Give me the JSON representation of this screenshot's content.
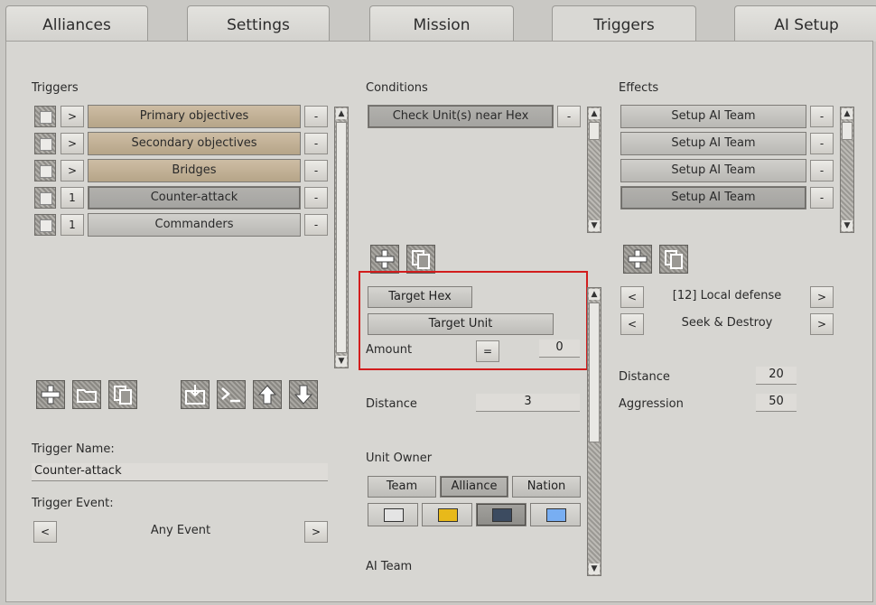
{
  "tabs": [
    {
      "label": "Alliances"
    },
    {
      "label": "Settings"
    },
    {
      "label": "Mission"
    },
    {
      "label": "Triggers"
    },
    {
      "label": "AI Setup"
    }
  ],
  "triggers": {
    "heading": "Triggers",
    "items": [
      {
        "arrow": ">",
        "label": "Primary objectives",
        "remove": "-"
      },
      {
        "arrow": ">",
        "label": "Secondary objectives",
        "remove": "-"
      },
      {
        "arrow": ">",
        "label": "Bridges",
        "remove": "-"
      },
      {
        "arrow": "1",
        "label": "Counter-attack",
        "remove": "-"
      },
      {
        "arrow": "1",
        "label": "Commanders",
        "remove": "-"
      }
    ],
    "name_label": "Trigger Name:",
    "name_value": "Counter-attack",
    "event_label": "Trigger Event:",
    "event_prev": "<",
    "event_value": "Any Event",
    "event_next": ">"
  },
  "conditions": {
    "heading": "Conditions",
    "items": [
      {
        "label": "Check Unit(s) near Hex",
        "remove": "-"
      }
    ],
    "target_hex": "Target Hex",
    "target_unit": "Target Unit",
    "amount_label": "Amount",
    "amount_op": "=",
    "amount_value": "0",
    "distance_label": "Distance",
    "distance_value": "3",
    "unit_owner_label": "Unit Owner",
    "owner_team": "Team",
    "owner_alliance": "Alliance",
    "owner_nation": "Nation",
    "ai_team_label": "AI Team",
    "swatch_colors": [
      "#e4e4e4",
      "#e8b91a",
      "#3c4b60",
      "#78aef2"
    ]
  },
  "effects": {
    "heading": "Effects",
    "items": [
      {
        "label": "Setup AI Team",
        "remove": "-"
      },
      {
        "label": "Setup AI Team",
        "remove": "-"
      },
      {
        "label": "Setup AI Team",
        "remove": "-"
      },
      {
        "label": "Setup AI Team",
        "remove": "-"
      }
    ],
    "prev": "<",
    "next": ">",
    "option1": "[12] Local defense",
    "option2": "Seek & Destroy",
    "distance_label": "Distance",
    "distance_value": "20",
    "aggression_label": "Aggression",
    "aggression_value": "50"
  },
  "colors": {
    "highlight": "#d21d1d",
    "tan_bar": "#c4b394"
  }
}
